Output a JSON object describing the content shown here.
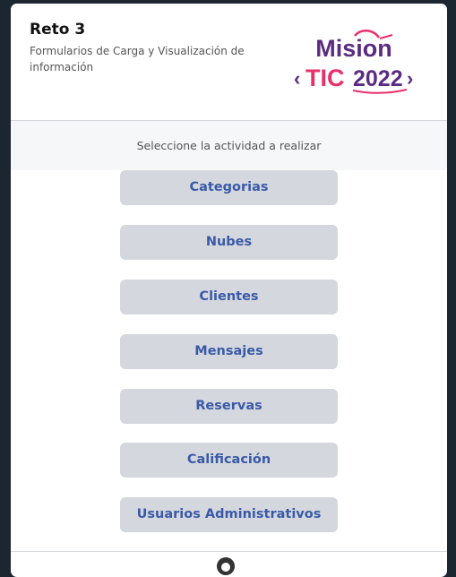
{
  "header": {
    "title": "Reto 3",
    "subtitle": "Formularios de Carga y Visualización de información",
    "logo": {
      "line1": "Mision",
      "line2a": "TIC",
      "line2b": "2022"
    }
  },
  "prompt": "Seleccione la actividad a realizar",
  "menu": [
    "Categorias",
    "Nubes",
    "Clientes",
    "Mensajes",
    "Reservas",
    "Calificación",
    "Usuarios Administrativos"
  ],
  "colors": {
    "background": "#1b2631",
    "button_bg": "#d4d7de",
    "button_text": "#3a5aa8",
    "logo_purple": "#5b2b82",
    "logo_pink": "#e8306b"
  },
  "footer": {
    "icon": "github-icon"
  }
}
